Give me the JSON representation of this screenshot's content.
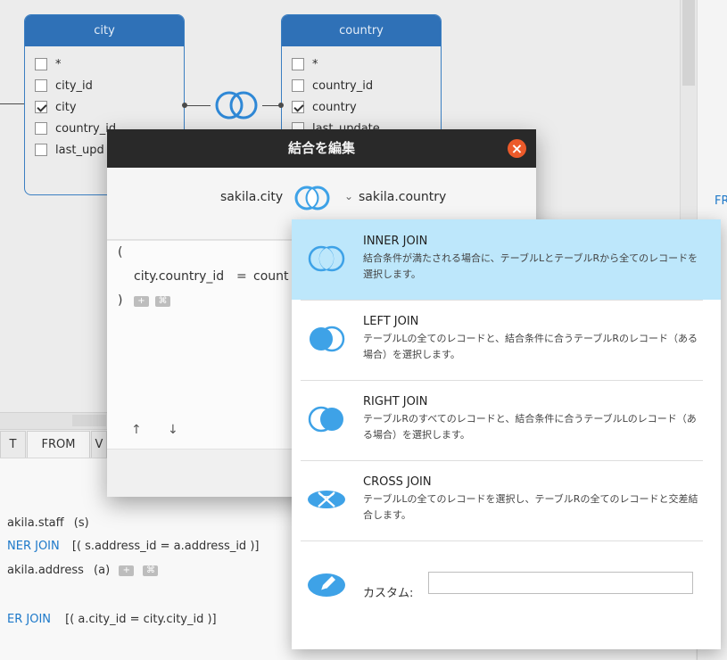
{
  "tables": {
    "city": {
      "title": "city",
      "fields": [
        {
          "label": "*",
          "checked": false
        },
        {
          "label": "city_id",
          "checked": false
        },
        {
          "label": "city",
          "checked": true
        },
        {
          "label": "country_id",
          "checked": false
        },
        {
          "label": "last_upd",
          "checked": false
        }
      ]
    },
    "country": {
      "title": "country",
      "fields": [
        {
          "label": "*",
          "checked": false
        },
        {
          "label": "country_id",
          "checked": false
        },
        {
          "label": "country",
          "checked": true
        },
        {
          "label": "last_update",
          "checked": false
        }
      ]
    }
  },
  "dialog": {
    "title": "結合を編集",
    "left_table": "sakila.city",
    "right_table": "sakila.country",
    "editor": {
      "open_paren": "(",
      "condition_left": "city.country_id",
      "condition_operator": "=",
      "condition_right": "count",
      "close_paren": ")"
    },
    "arrows": {
      "up": "↑",
      "down": "↓"
    }
  },
  "join_menu": {
    "options": [
      {
        "title": "INNER JOIN",
        "description": "結合条件が満たされる場合に、テーブルLとテーブルRから全てのレコードを選択します。"
      },
      {
        "title": "LEFT JOIN",
        "description": "テーブルLの全てのレコードと、結合条件に合うテーブルRのレコード（ある場合）を選択します。"
      },
      {
        "title": "RIGHT JOIN",
        "description": "テーブルRのすべてのレコードと、結合条件に合うテーブルLのレコード（ある場合）を選択します。"
      },
      {
        "title": "CROSS JOIN",
        "description": "テーブルLの全てのレコードを選択し、テーブルRの全てのレコードと交差結合します。"
      }
    ],
    "custom_label": "カスタム:",
    "custom_value": ""
  },
  "lower_panel": {
    "tabs": [
      "T",
      "FROM",
      "V"
    ],
    "lines": [
      {
        "prefix": "akila.staff",
        "suffix": "(s)"
      },
      {
        "prefix": "NER JOIN",
        "suffix": "[( s.address_id = a.address_id )]"
      },
      {
        "prefix": "akila.address",
        "suffix": "(a)"
      },
      {
        "prefix": "ER JOIN",
        "suffix": "[( a.city_id = city.city_id )]"
      }
    ]
  },
  "side_label": "FR",
  "colors": {
    "accent_blue": "#2f71b7",
    "selection_blue": "#bde7fb",
    "close_red": "#ec5a2a",
    "icon_blue": "#3ea2e7"
  }
}
